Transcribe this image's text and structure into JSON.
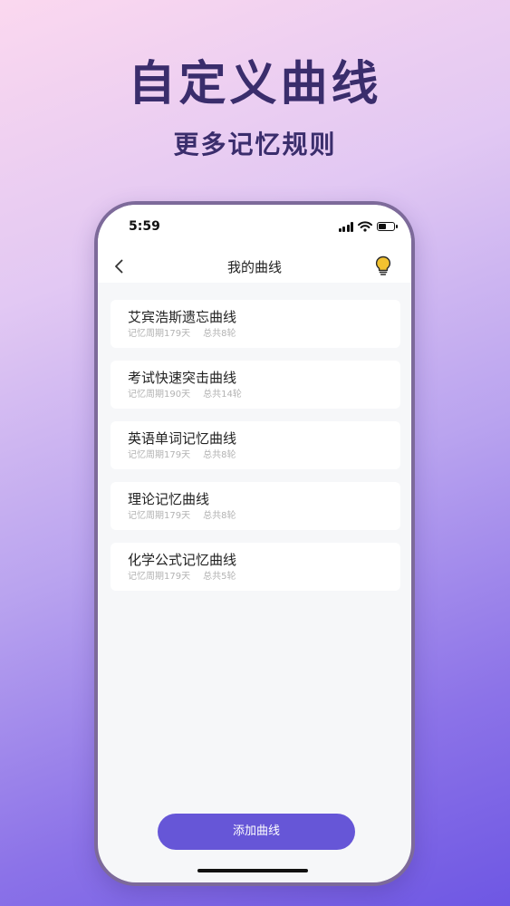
{
  "promo": {
    "title": "自定义曲线",
    "subtitle": "更多记忆规则"
  },
  "status_bar": {
    "time": "5:59",
    "icons": [
      "signal-icon",
      "wifi-icon",
      "battery-icon"
    ]
  },
  "nav": {
    "back_icon": "chevron-left-icon",
    "title": "我的曲线",
    "hint_icon": "lightbulb-icon"
  },
  "curves": [
    {
      "name": "艾宾浩斯遗忘曲线",
      "period": "记忆周期179天",
      "rounds": "总共8轮"
    },
    {
      "name": "考试快速突击曲线",
      "period": "记忆周期190天",
      "rounds": "总共14轮"
    },
    {
      "name": "英语单词记忆曲线",
      "period": "记忆周期179天",
      "rounds": "总共8轮"
    },
    {
      "name": "理论记忆曲线",
      "period": "记忆周期179天",
      "rounds": "总共8轮"
    },
    {
      "name": "化学公式记忆曲线",
      "period": "记忆周期179天",
      "rounds": "总共5轮"
    }
  ],
  "actions": {
    "add_label": "添加曲线"
  },
  "colors": {
    "accent": "#6656d7",
    "title_text": "#3a2d6c",
    "bulb": "#f2c230"
  }
}
